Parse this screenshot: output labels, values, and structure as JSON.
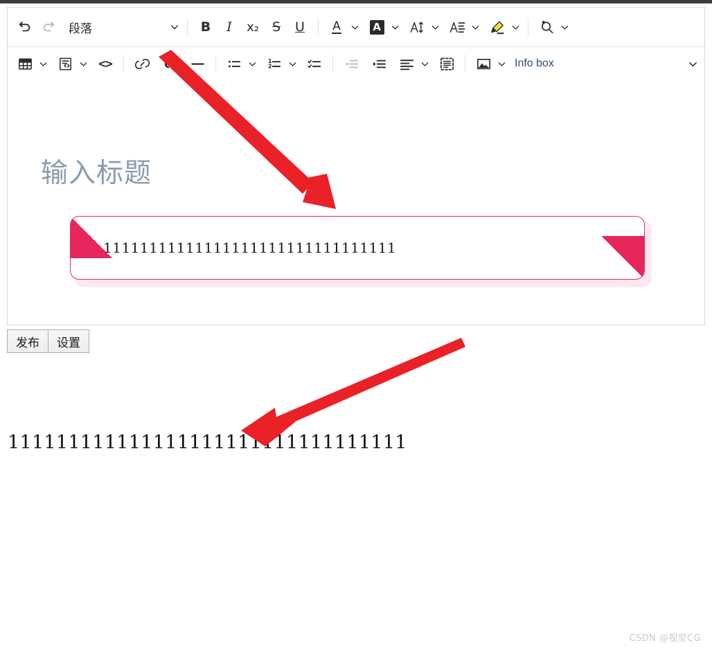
{
  "app": {
    "watermark": "CSDN @视觉CG"
  },
  "toolbar": {
    "row1": {
      "undo": "undo-icon",
      "redo": "redo-icon",
      "paragraph_label": "段落",
      "bold": "B",
      "italic": "I",
      "subscript": "x₂",
      "strikethrough": "S",
      "underline": "U",
      "text_color": "A",
      "background_color": "A",
      "font_size": "font-size-icon",
      "line_height": "line-height-icon",
      "highlighter": "highlighter-icon",
      "find_replace": "find-replace-icon"
    },
    "row2": {
      "table": "table-icon",
      "code_block": "code-block-icon",
      "inline_code": "<>",
      "link": "link-icon",
      "quote": "quote-icon",
      "horizontal_rule": "horizontal-rule-icon",
      "bullet_list": "bullet-list-icon",
      "numbered_list": "numbered-list-icon",
      "check_list": "check-list-icon",
      "outdent": "outdent-icon",
      "indent": "indent-icon",
      "align": "align-left-icon",
      "custom_block": "dashed-block-icon",
      "image": "image-icon",
      "infobox_label": "Info box"
    }
  },
  "editor": {
    "title_placeholder": "输入标题",
    "info_box": {
      "text": "11111111111111111111111111111111",
      "accent_color": "#e8265e",
      "shadow_color": "#fce9ef"
    }
  },
  "actions": {
    "publish_label": "发布",
    "settings_label": "设置"
  },
  "preview": {
    "output_text": "111111111111111111111111111111111"
  },
  "annotations": {
    "color": "#ea2127",
    "arrow_1": {
      "from": "link-icon",
      "to": "info-box-top-edge"
    },
    "arrow_2": {
      "from": "below-settings-button",
      "to": "output-text"
    }
  }
}
